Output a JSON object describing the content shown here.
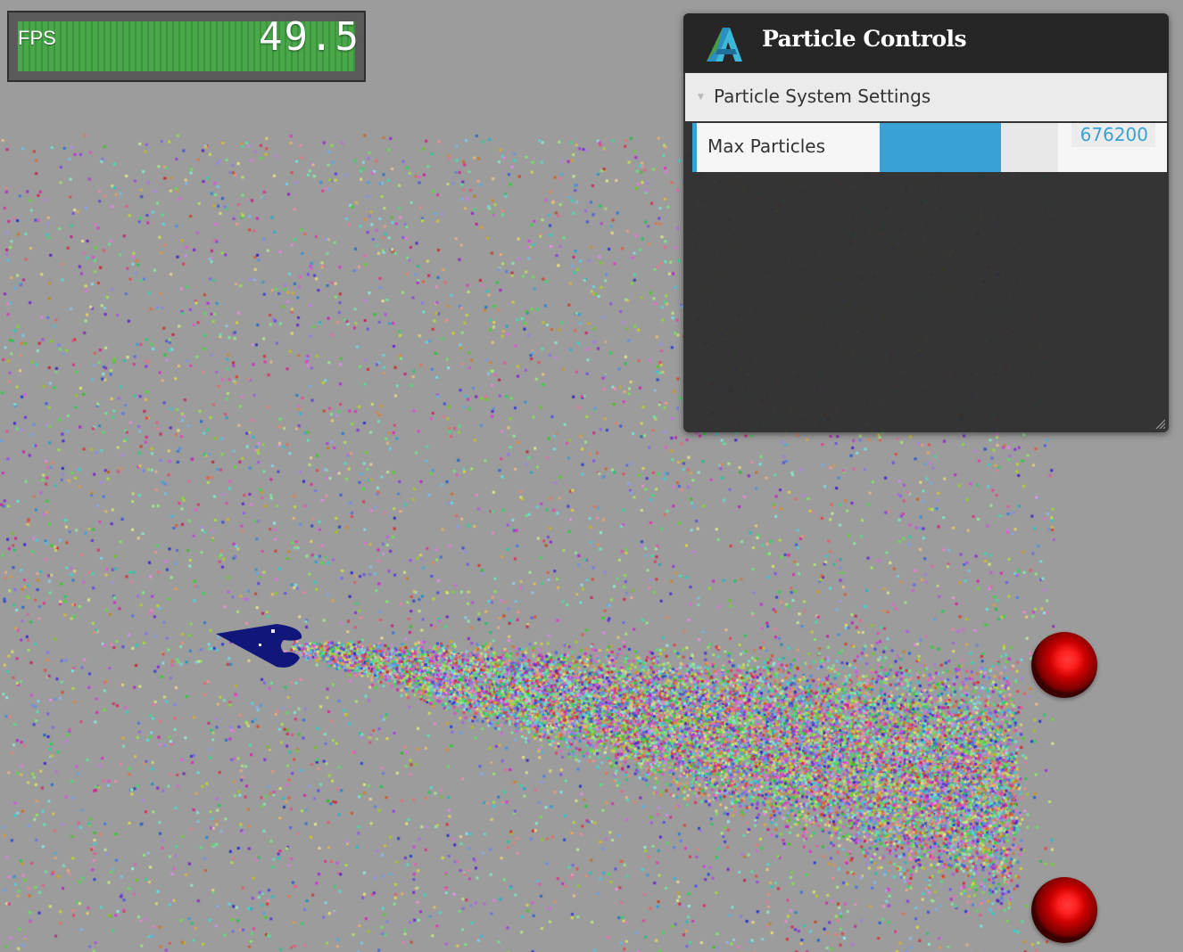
{
  "fps": {
    "label": "FPS",
    "value": "49.5"
  },
  "panel": {
    "title": "Particle Controls",
    "section_title": "Particle System Settings",
    "rows": [
      {
        "label": "Max Particles",
        "value": "676200",
        "slider_fraction": 0.68
      }
    ]
  },
  "colors": {
    "accent": "#38a1d6",
    "background": "#9c9c9c",
    "fps_green": "#4aa84a",
    "ship": "#10167a",
    "sphere": "#cc0000"
  },
  "scene": {
    "objects": [
      "particle-field",
      "blue-emitter-ship",
      "red-sphere",
      "red-sphere"
    ]
  }
}
